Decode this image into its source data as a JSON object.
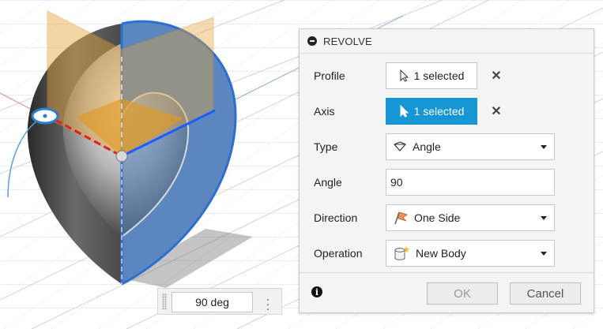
{
  "dialog": {
    "title": "REVOLVE",
    "rows": {
      "profile": {
        "label": "Profile",
        "value": "1 selected"
      },
      "axis": {
        "label": "Axis",
        "value": "1 selected"
      },
      "type": {
        "label": "Type",
        "value": "Angle"
      },
      "angle": {
        "label": "Angle",
        "value": "90"
      },
      "direction": {
        "label": "Direction",
        "value": "One Side"
      },
      "operation": {
        "label": "Operation",
        "value": "New Body"
      }
    },
    "ok_label": "OK",
    "cancel_label": "Cancel"
  },
  "canvas": {
    "angle_input": "90 deg"
  },
  "colors": {
    "accent": "#1796d4",
    "body_blue": "#4a7ab0",
    "preview_orange": "#e8a53a",
    "grid": "#d6d6d6"
  },
  "icons": [
    "collapse-icon",
    "cursor-select-icon",
    "clear-selection-icon",
    "angle-type-icon",
    "direction-flag-icon",
    "new-body-icon",
    "info-icon",
    "more-options-icon"
  ]
}
